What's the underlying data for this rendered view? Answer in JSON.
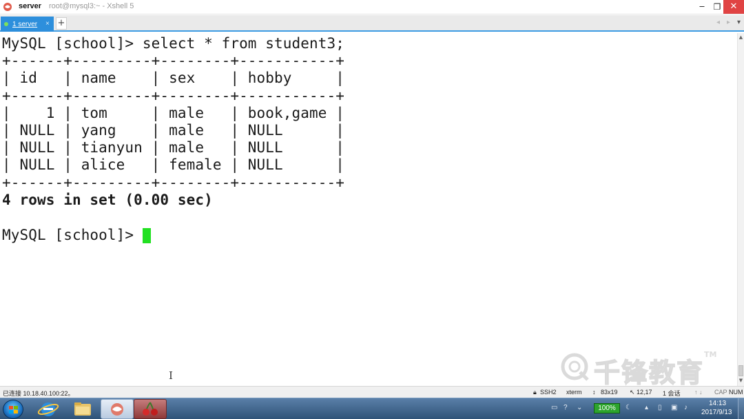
{
  "window": {
    "title_name": "server",
    "title_detail": "root@mysql3:~ - Xshell 5",
    "minimize": "‒",
    "maximize": "❐",
    "close": "✕"
  },
  "tabs": {
    "items": [
      {
        "label": "1 server",
        "close": "×"
      }
    ],
    "add": "+",
    "nav_left": "◂",
    "nav_right": "▸",
    "nav_menu": "▾"
  },
  "terminal": {
    "lines": [
      "MySQL [school]> select * from student3;",
      "+------+---------+--------+-----------+",
      "| id   | name    | sex    | hobby     |",
      "+------+---------+--------+-----------+",
      "|    1 | tom     | male   | book,game |",
      "| NULL | yang    | male   | NULL      |",
      "| NULL | tianyun | male   | NULL      |",
      "| NULL | alice   | female | NULL      |",
      "+------+---------+--------+-----------+",
      "4 rows in set (0.00 sec)",
      "",
      "MySQL [school]> "
    ],
    "cursor_color": "#22e022"
  },
  "watermark": {
    "text": "千锋教育",
    "tm": "TM"
  },
  "statusbar": {
    "connection": "已连接 10.18.40.100:22。",
    "protocol": "SSH2",
    "terminal_type": "xterm",
    "size": "83x19",
    "cursor_pos": "12,17",
    "sessions": "1 会话",
    "caps": "CAP",
    "num": "NUM"
  },
  "taskbar": {
    "battery": "100%",
    "time": "14:13",
    "date": "2017/9/13"
  }
}
